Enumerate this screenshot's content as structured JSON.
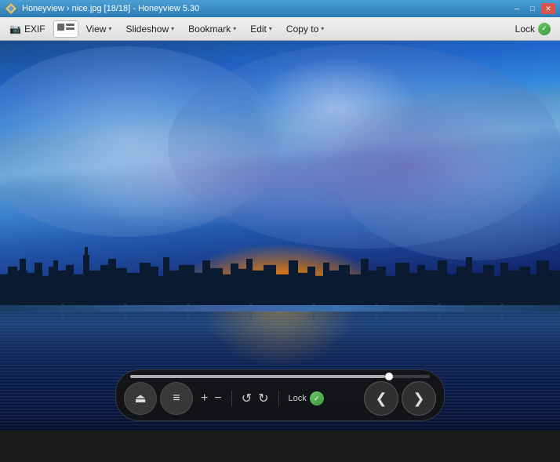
{
  "titleBar": {
    "appName": "Honeyview",
    "fileName": "nice.jpg [18/18]",
    "appVersion": "Honeyview 5.30",
    "fullTitle": "Honeyview › nice.jpg [18/18] - Honeyview 5.30",
    "minimizeLabel": "─",
    "maximizeLabel": "□",
    "closeLabel": "✕"
  },
  "menuBar": {
    "exif": "EXIF",
    "viewLabel": "View",
    "slideshowLabel": "Slideshow",
    "bookmarkLabel": "Bookmark",
    "editLabel": "Edit",
    "copyToLabel": "Copy to",
    "lockLabel": "Lock",
    "dropdownArrow": "▾"
  },
  "toolbar": {
    "ejectLabel": "⏏",
    "menuLabel": "≡",
    "zoomInLabel": "+",
    "zoomOutLabel": "−",
    "rotateLeftLabel": "↺",
    "rotateRightLabel": "↻",
    "lockLabel": "Lock",
    "prevLabel": "❮",
    "nextLabel": "❯"
  },
  "progressBar": {
    "fillPercent": 85
  }
}
